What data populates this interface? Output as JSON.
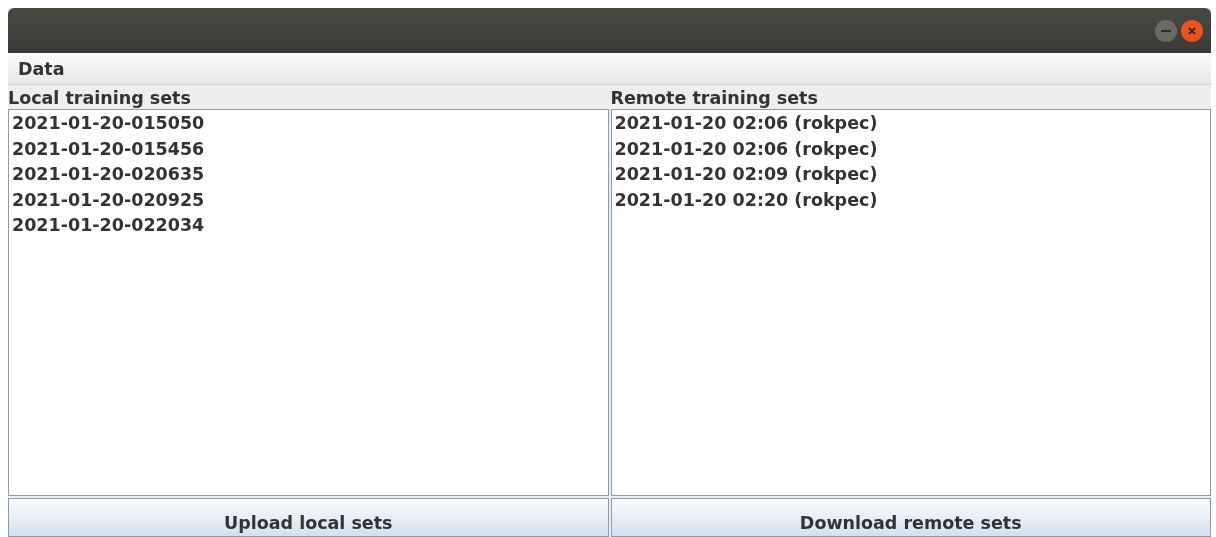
{
  "menu": [
    "Data"
  ],
  "panels": [
    {
      "title": "Local training sets",
      "items": [
        "2021-01-20-015050",
        "2021-01-20-015456",
        "2021-01-20-020635",
        "2021-01-20-020925",
        "2021-01-20-022034"
      ],
      "button": "Upload local sets"
    },
    {
      "title": "Remote training sets",
      "items": [
        "2021-01-20 02:06 (rokpec)",
        "2021-01-20 02:06 (rokpec)",
        "2021-01-20 02:09 (rokpec)",
        "2021-01-20 02:20 (rokpec)"
      ],
      "button": "Download remote sets"
    }
  ]
}
